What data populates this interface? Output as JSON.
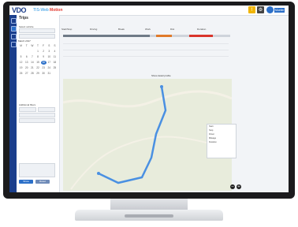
{
  "header": {
    "logo": "VDO",
    "brand_prefix": "TIS-Web",
    "brand_suffix": "Motion",
    "user_name": "Mueller"
  },
  "sidebar": {
    "title": "Trips",
    "vehicle_label": "Select vehicle",
    "calendar_month": "March 2017",
    "weekdays": [
      "M",
      "T",
      "W",
      "T",
      "F",
      "S",
      "S"
    ],
    "days": [
      "",
      "",
      "",
      "1",
      "2",
      "3",
      "4",
      "5",
      "6",
      "7",
      "8",
      "9",
      "10",
      "11",
      "12",
      "13",
      "14",
      "15",
      "16",
      "17",
      "18",
      "19",
      "20",
      "21",
      "22",
      "23",
      "24",
      "25",
      "26",
      "27",
      "28",
      "29",
      "30",
      "31",
      ""
    ],
    "selected_day": "16",
    "filters_label": "Additional filters",
    "button_apply": "Show",
    "button_reset": "Reset"
  },
  "stats": [
    "Start/Stop",
    "Driving",
    "Break",
    "Work",
    "Dist",
    "Duration"
  ],
  "map": {
    "toolbar_label": "Show detail profile",
    "popup_lines": [
      "Start",
      "Stop",
      "Driver",
      "Mileage",
      "Duration"
    ]
  },
  "colors": {
    "accent": "#2b6fc8",
    "route": "#4a90e2",
    "topbar_yellow": "#f0b400",
    "topbar_red": "#d9342b"
  }
}
